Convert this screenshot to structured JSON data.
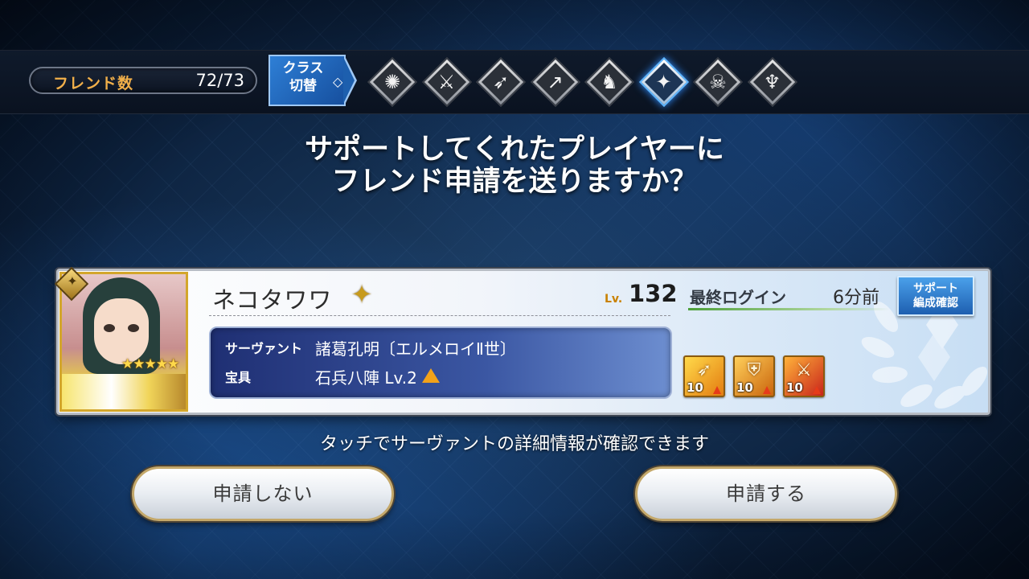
{
  "topbar": {
    "friend_label": "フレンド数",
    "friend_count": "72/73",
    "class_switch_label": "クラス\n切替",
    "class_icons": [
      {
        "name": "all-class-icon",
        "glyph": "✺",
        "selected": false
      },
      {
        "name": "saber-class-icon",
        "glyph": "⚔",
        "selected": false
      },
      {
        "name": "archer-class-icon",
        "glyph": "➶",
        "selected": false
      },
      {
        "name": "lancer-class-icon",
        "glyph": "↗",
        "selected": false
      },
      {
        "name": "rider-class-icon",
        "glyph": "♞",
        "selected": false
      },
      {
        "name": "caster-class-icon",
        "glyph": "✦",
        "selected": true
      },
      {
        "name": "assassin-class-icon",
        "glyph": "☠",
        "selected": false
      },
      {
        "name": "berserker-class-icon",
        "glyph": "♆",
        "selected": false
      }
    ]
  },
  "prompt": {
    "line1": "サポートしてくれたプレイヤーに",
    "line2": "フレンド申請を送りますか？"
  },
  "card": {
    "player_name": "ネコタワワ",
    "name_emblem": "✦",
    "lv_label": "Lv.",
    "lv_value": "132",
    "last_login_label": "最終ログイン",
    "last_login_value": "6分前",
    "support_button_label": "サポート\n編成確認",
    "servant_label": "サーヴァント",
    "servant_value": "諸葛孔明〔エルメロイⅡ世〕",
    "np_label": "宝具",
    "np_value": "石兵八陣 Lv.2",
    "rarity_stars": "★★★★★",
    "class_badge_glyph": "✦",
    "skills": [
      {
        "symbol": "➶",
        "level": "10"
      },
      {
        "symbol": "⛨",
        "level": "10"
      },
      {
        "symbol": "⚔",
        "level": "10"
      }
    ]
  },
  "hint": "タッチでサーヴァントの詳細情報が確認できます",
  "buttons": {
    "decline": "申請しない",
    "accept": "申請する"
  }
}
